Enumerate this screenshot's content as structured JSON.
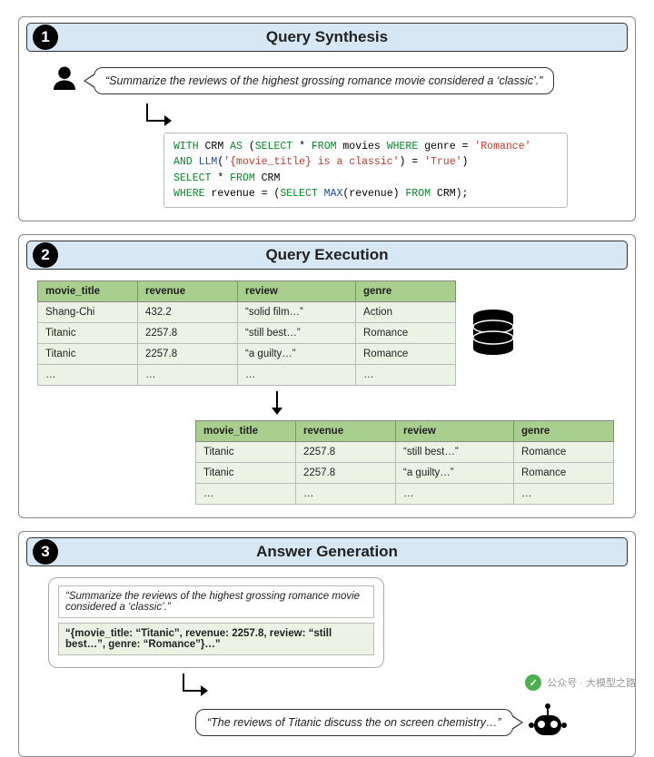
{
  "section1": {
    "step": "1",
    "title": "Query Synthesis",
    "user_query": "“Summarize the reviews of the highest grossing romance movie considered a ‘classic’.”",
    "sql_tokens": [
      {
        "t": "WITH",
        "c": "green"
      },
      {
        "t": " CRM ",
        "c": "black"
      },
      {
        "t": "AS",
        "c": "green"
      },
      {
        "t": " (",
        "c": "black"
      },
      {
        "t": "SELECT",
        "c": "green"
      },
      {
        "t": " * ",
        "c": "black"
      },
      {
        "t": "FROM",
        "c": "green"
      },
      {
        "t": " movies ",
        "c": "black"
      },
      {
        "t": "WHERE",
        "c": "green"
      },
      {
        "t": " genre = ",
        "c": "black"
      },
      {
        "t": "'Romance'",
        "c": "red"
      },
      {
        "t": "\n",
        "c": "black"
      },
      {
        "t": "AND",
        "c": "green"
      },
      {
        "t": " ",
        "c": "black"
      },
      {
        "t": "LLM",
        "c": "blue"
      },
      {
        "t": "(",
        "c": "black"
      },
      {
        "t": "'{movie_title} is a classic'",
        "c": "red"
      },
      {
        "t": ") = ",
        "c": "black"
      },
      {
        "t": "'True'",
        "c": "red"
      },
      {
        "t": ")\n",
        "c": "black"
      },
      {
        "t": "SELECT",
        "c": "green"
      },
      {
        "t": " * ",
        "c": "black"
      },
      {
        "t": "FROM",
        "c": "green"
      },
      {
        "t": " CRM\n",
        "c": "black"
      },
      {
        "t": "WHERE",
        "c": "green"
      },
      {
        "t": " revenue = (",
        "c": "black"
      },
      {
        "t": "SELECT",
        "c": "green"
      },
      {
        "t": " ",
        "c": "black"
      },
      {
        "t": "MAX",
        "c": "blue"
      },
      {
        "t": "(revenue) ",
        "c": "black"
      },
      {
        "t": "FROM",
        "c": "green"
      },
      {
        "t": " CRM);",
        "c": "black"
      }
    ]
  },
  "section2": {
    "step": "2",
    "title": "Query Execution",
    "table1": {
      "headers": [
        "movie_title",
        "revenue",
        "review",
        "genre"
      ],
      "rows": [
        [
          "Shang-Chi",
          "432.2",
          "“solid film…”",
          "Action"
        ],
        [
          "Titanic",
          "2257.8",
          "“still best…”",
          "Romance"
        ],
        [
          "Titanic",
          "2257.8",
          "“a guilty…”",
          "Romance"
        ],
        [
          "…",
          "…",
          "…",
          "…"
        ]
      ]
    },
    "table2": {
      "headers": [
        "movie_title",
        "revenue",
        "review",
        "genre"
      ],
      "rows": [
        [
          "Titanic",
          "2257.8",
          "“still best…”",
          "Romance"
        ],
        [
          "Titanic",
          "2257.8",
          "“a guilty…”",
          "Romance"
        ],
        [
          "…",
          "…",
          "…",
          "…"
        ]
      ]
    }
  },
  "section3": {
    "step": "3",
    "title": "Answer Generation",
    "input_query": "“Summarize the reviews of the highest grossing romance movie considered a ‘classic’.”",
    "input_result": "“{movie_title: “Titanic”, revenue: 2257.8, review: “still best…”, genre: “Romance”}…”",
    "answer": "“The reviews of Titanic discuss the on screen chemistry…”"
  },
  "watermark": "公众号 · 大模型之路"
}
